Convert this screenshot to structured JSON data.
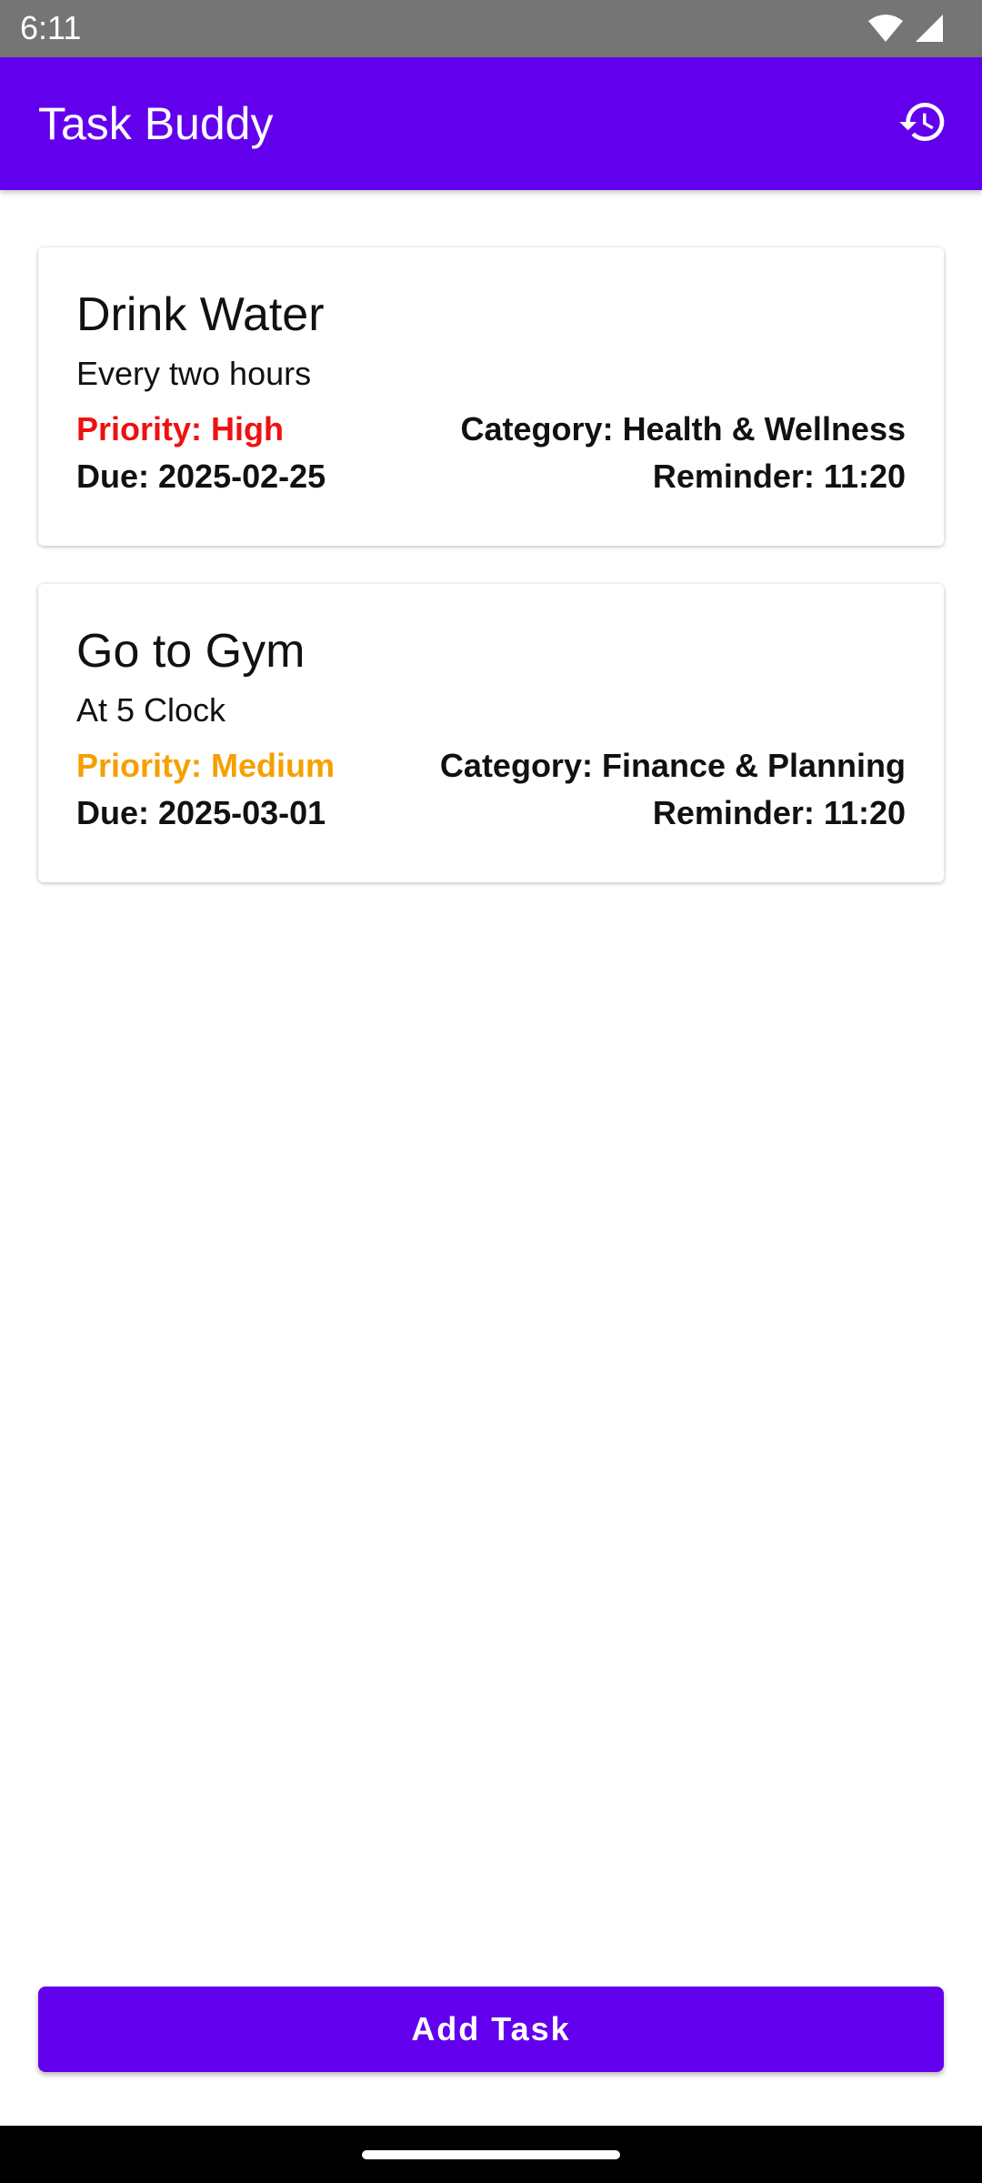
{
  "status_bar": {
    "time": "6:11",
    "icons": [
      "wifi-icon",
      "signal-icon"
    ]
  },
  "app_bar": {
    "title": "Task Buddy",
    "action_icon": "history-icon",
    "color": "#6200ee"
  },
  "tasks": [
    {
      "title": "Drink Water",
      "description": "Every two hours",
      "priority": "Priority: High",
      "priority_color": "#ee1111",
      "category": "Category: Health & Wellness",
      "due": "Due: 2025-02-25",
      "reminder": "Reminder: 11:20"
    },
    {
      "title": "Go to Gym",
      "description": "At 5 Clock",
      "priority": "Priority: Medium",
      "priority_color": "#f5a000",
      "category": "Category: Finance & Planning",
      "due": "Due: 2025-03-01",
      "reminder": "Reminder: 11:20"
    }
  ],
  "footer": {
    "add_task_label": "Add Task"
  }
}
